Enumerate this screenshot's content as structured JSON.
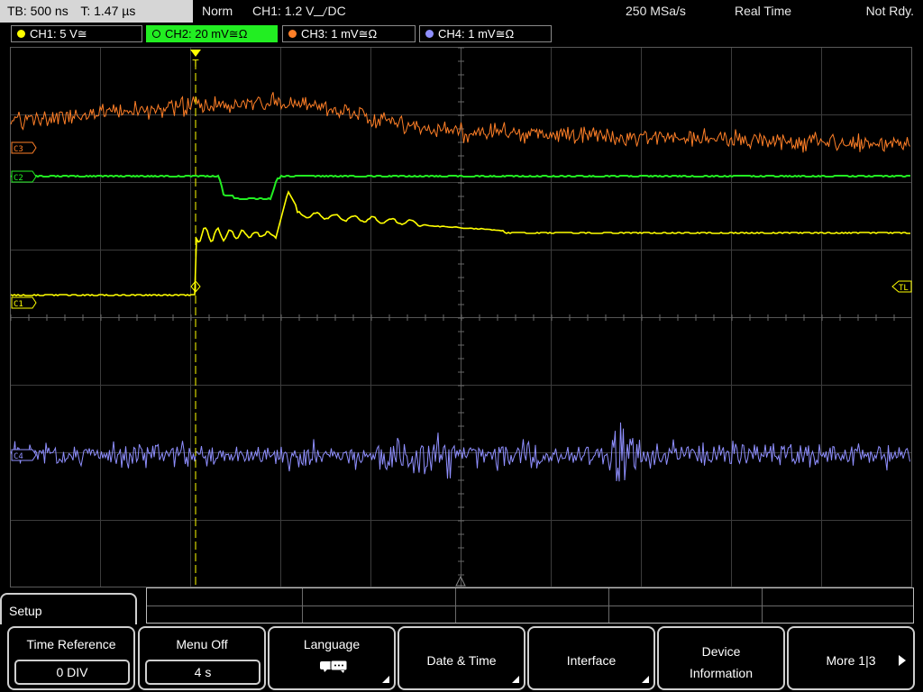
{
  "topbar": {
    "timebase": "TB: 500 ns",
    "trigger_time": "T: 1.47 µs",
    "mode": "Norm",
    "trigger_source": "CH1: 1.2 V",
    "trigger_coupling": "DC",
    "sample_rate": "250 MSa/s",
    "acquisition": "Real Time",
    "status": "Not Rdy."
  },
  "channels": [
    {
      "label": "CH1: 5 V≅",
      "color": "#ffff00",
      "active": false
    },
    {
      "label": "CH2: 20 mV≅Ω",
      "color": "#22ee22",
      "active": true
    },
    {
      "label": "CH3: 1 mV≅Ω",
      "color": "#ff7f27",
      "active": false
    },
    {
      "label": "CH4: 1 mV≅Ω",
      "color": "#8f8fff",
      "active": false
    }
  ],
  "markers": {
    "c3": "C3",
    "c2": "C2",
    "c1": "C1",
    "c4": "C4",
    "trigger_level": "TL"
  },
  "menu": {
    "title": "Setup",
    "softkeys": [
      {
        "title": "Time Reference",
        "value": "0 DIV"
      },
      {
        "title": "Menu Off",
        "value": "4 s"
      },
      {
        "title": "Language",
        "icon": "speech-bubbles-icon"
      },
      {
        "title": "Date & Time"
      },
      {
        "title": "Interface"
      },
      {
        "title": "Device",
        "title2": "Information"
      },
      {
        "title": "More 1|3"
      }
    ]
  }
}
